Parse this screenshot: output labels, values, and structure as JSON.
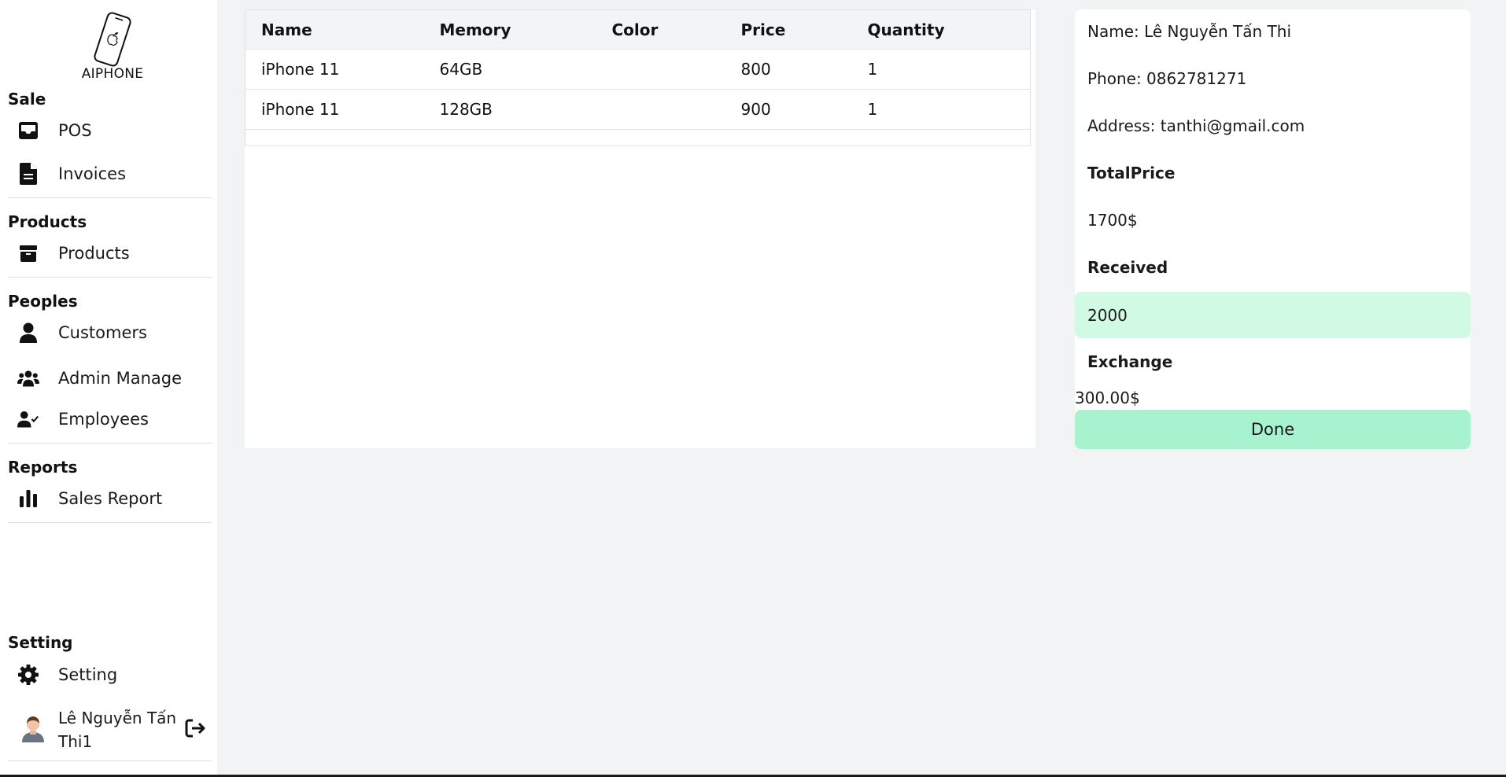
{
  "brand": {
    "name": "AIPHONE",
    "icon": "phone-apple-icon"
  },
  "sidebar": {
    "sections": {
      "sale": "Sale",
      "products": "Products",
      "peoples": "Peoples",
      "reports": "Reports",
      "setting": "Setting"
    },
    "items": {
      "pos": {
        "label": "POS",
        "icon": "inbox-tray-icon"
      },
      "invoices": {
        "label": "Invoices",
        "icon": "file-icon"
      },
      "products": {
        "label": "Products",
        "icon": "box-icon"
      },
      "customers": {
        "label": "Customers",
        "icon": "user-icon"
      },
      "admin_manage": {
        "label": "Admin Manage",
        "icon": "users-group-icon"
      },
      "employees": {
        "label": "Employees",
        "icon": "user-check-icon"
      },
      "sales_report": {
        "label": "Sales Report",
        "icon": "bar-chart-icon"
      },
      "setting": {
        "label": "Setting",
        "icon": "gear-icon"
      }
    },
    "user": {
      "name": "Lê Nguyễn Tấn Thi1",
      "avatar": "avatar-icon",
      "logout_icon": "logout-icon"
    }
  },
  "cart": {
    "columns": [
      "Name",
      "Memory",
      "Color",
      "Price",
      "Quantity"
    ],
    "rows": [
      [
        "iPhone 11",
        "64GB",
        "",
        "800",
        "1"
      ],
      [
        "iPhone 11",
        "128GB",
        "",
        "900",
        "1"
      ]
    ]
  },
  "checkout": {
    "name_line": "Name: Lê Nguyễn Tấn Thi",
    "phone_line": "Phone: 0862781271",
    "address_line": "Address: tanthi@gmail.com",
    "total_label": "TotalPrice",
    "total_value": "1700$",
    "received_label": "Received",
    "received_value": "2000",
    "exchange_label": "Exchange",
    "exchange_value": "300.00$",
    "done_label": "Done"
  },
  "colors": {
    "received_bg": "#d1fae5",
    "done_bg": "#a7f3d0",
    "page_bg": "#f2f3f5"
  }
}
